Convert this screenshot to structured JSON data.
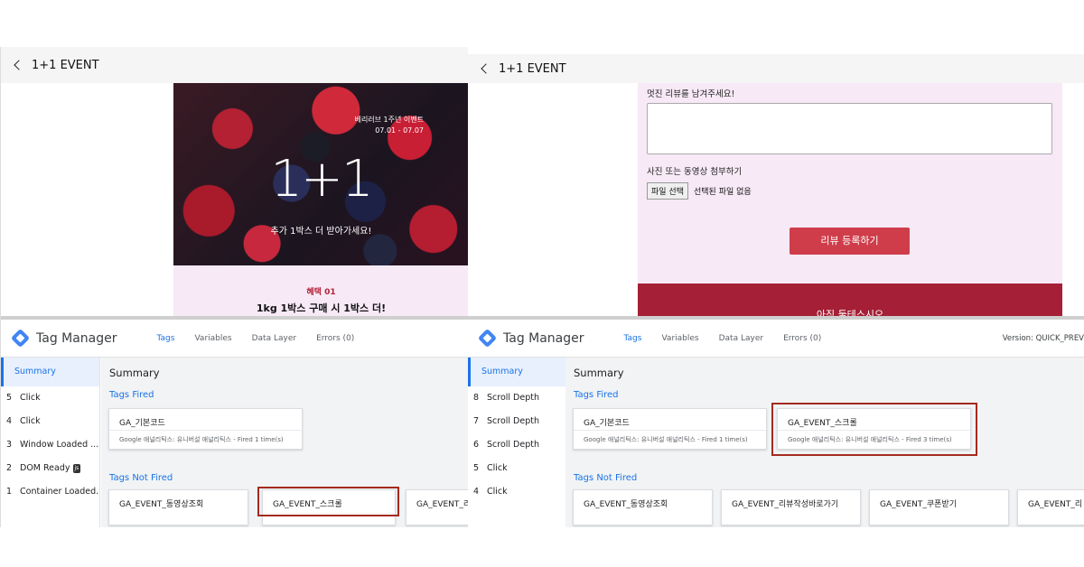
{
  "left": {
    "header": {
      "title": "1+1 EVENT"
    },
    "hero": {
      "event_name": "베리러브 1주년 이벤트",
      "dates": "07.01  -  07.07",
      "headline": "1+1",
      "tagline": "추가 1박스 더 받아가세요!"
    },
    "benefit": {
      "label": "혜택 01",
      "title": "1kg 1박스 구매 시 1박스 더!"
    },
    "gtm": {
      "title": "Tag Manager",
      "tabs": [
        "Tags",
        "Variables",
        "Data Layer",
        "Errors (0)"
      ],
      "sidebar": {
        "summary": "Summary",
        "events": [
          {
            "num": "5",
            "label": "Click"
          },
          {
            "num": "4",
            "label": "Click"
          },
          {
            "num": "3",
            "label": "Window Loaded ..."
          },
          {
            "num": "2",
            "label": "DOM Ready",
            "badge": "js"
          },
          {
            "num": "1",
            "label": "Container Loaded..."
          }
        ]
      },
      "main": {
        "heading": "Summary",
        "fired_label": "Tags Fired",
        "fired": [
          {
            "name": "GA_기본코드",
            "info": "Google 애널리틱스: 유니버설 애널리틱스 - Fired 1 time(s)"
          }
        ],
        "not_fired_label": "Tags Not Fired",
        "not_fired": [
          "GA_EVENT_동영상조회",
          "GA_EVENT_스크롤",
          "GA_EVENT_리"
        ]
      }
    }
  },
  "right": {
    "header": {
      "title": "1+1 EVENT"
    },
    "form": {
      "review_label": "멋진 리뷰를 남겨주세요!",
      "attach_label": "사진 또는 동영상 첨부하기",
      "file_button": "파일 선택",
      "file_status": "선택된 파일 없음",
      "submit": "리뷰 등록하기",
      "banner": "아직 둘테스시오"
    },
    "gtm": {
      "title": "Tag Manager",
      "tabs": [
        "Tags",
        "Variables",
        "Data Layer",
        "Errors (0)"
      ],
      "version": "Version: QUICK_PREV",
      "sidebar": {
        "summary": "Summary",
        "events": [
          {
            "num": "8",
            "label": "Scroll Depth"
          },
          {
            "num": "7",
            "label": "Scroll Depth"
          },
          {
            "num": "6",
            "label": "Scroll Depth"
          },
          {
            "num": "5",
            "label": "Click"
          },
          {
            "num": "4",
            "label": "Click"
          }
        ]
      },
      "main": {
        "heading": "Summary",
        "fired_label": "Tags Fired",
        "fired": [
          {
            "name": "GA_기본코드",
            "info": "Google 애널리틱스: 유니버설 애널리틱스 - Fired 1 time(s)"
          },
          {
            "name": "GA_EVENT_스크롤",
            "info": "Google 애널리틱스: 유니버설 애널리틱스 - Fired 3 time(s)"
          }
        ],
        "not_fired_label": "Tags Not Fired",
        "not_fired": [
          "GA_EVENT_동영상조회",
          "GA_EVENT_리뷰작성바로가기",
          "GA_EVENT_쿠폰받기",
          "GA_EVENT_리"
        ]
      }
    }
  },
  "colors": {
    "accent": "#1a73e8",
    "highlight": "#a52a1f",
    "brand_red": "#cf3d4a",
    "pink_bg": "#f7e9f6"
  }
}
